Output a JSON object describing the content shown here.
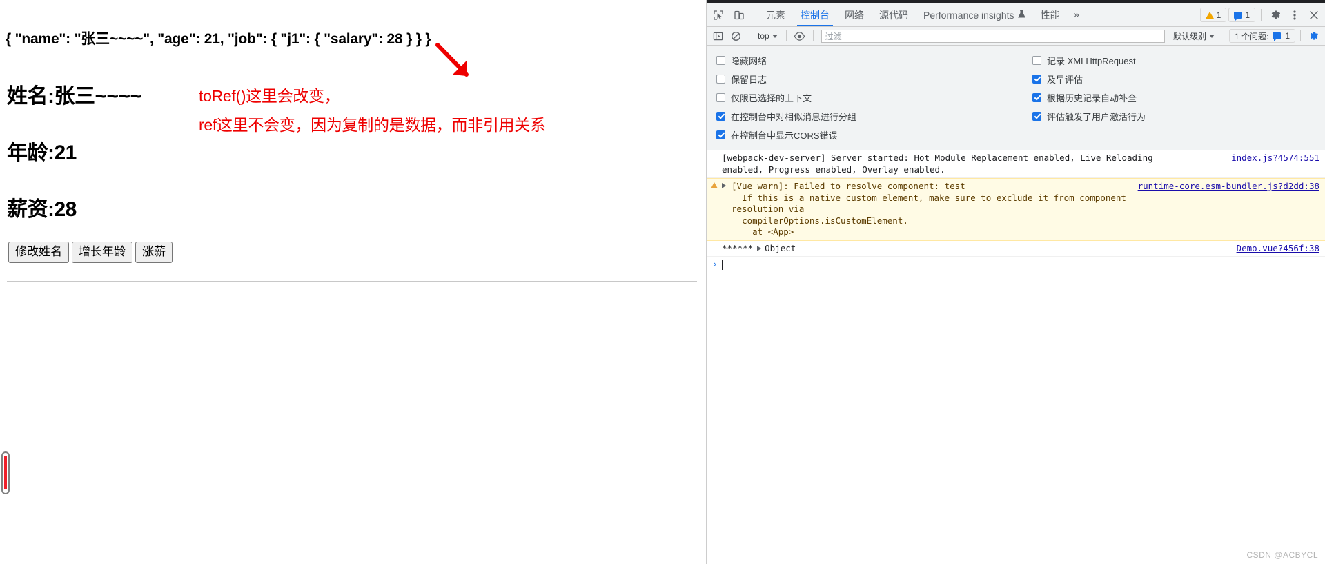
{
  "page": {
    "json_preview": "{ \"name\": \"张三~~~~\", \"age\": 21, \"job\": { \"j1\": { \"salary\": 28 } } }",
    "fields": {
      "name": "姓名:张三~~~~",
      "age": "年龄:21",
      "salary": "薪资:28"
    },
    "annotation": {
      "line1": "toRef()这里会改变，",
      "line2": "ref这里不会变，因为复制的是数据，而非引用关系",
      "color": "#ee0000"
    },
    "buttons": [
      {
        "label": "修改姓名",
        "name": "change-name-button"
      },
      {
        "label": "增长年龄",
        "name": "increase-age-button"
      },
      {
        "label": "涨薪",
        "name": "raise-salary-button"
      }
    ]
  },
  "devtools": {
    "tabs": [
      {
        "label": "元素",
        "active": false
      },
      {
        "label": "控制台",
        "active": true
      },
      {
        "label": "网络",
        "active": false
      },
      {
        "label": "源代码",
        "active": false
      },
      {
        "label": "Performance insights",
        "active": false,
        "flask": "⚗"
      },
      {
        "label": "性能",
        "active": false
      }
    ],
    "more_tabs_glyph": "»",
    "badges": {
      "warning_count": "1",
      "message_count": "1"
    },
    "console_toolbar": {
      "context": "top",
      "filter_placeholder": "过滤",
      "filter_value": "",
      "level": "默认级别",
      "issues_label": "1 个问题:",
      "issues_count": "1"
    },
    "settings_left": [
      {
        "label": "隐藏网络",
        "checked": false
      },
      {
        "label": "保留日志",
        "checked": false
      },
      {
        "label": "仅限已选择的上下文",
        "checked": false
      },
      {
        "label": "在控制台中对相似消息进行分组",
        "checked": true
      },
      {
        "label": "在控制台中显示CORS错误",
        "checked": true
      }
    ],
    "settings_right": [
      {
        "label": "记录 XMLHttpRequest",
        "checked": false
      },
      {
        "label": "及早评估",
        "checked": true
      },
      {
        "label": "根据历史记录自动补全",
        "checked": true
      },
      {
        "label": "评估触发了用户激活行为",
        "checked": true
      }
    ],
    "messages": [
      {
        "type": "log",
        "text": "[webpack-dev-server] Server started: Hot Module Replacement enabled, Live Reloading enabled, Progress enabled, Overlay enabled.",
        "source": "index.js?4574:551"
      },
      {
        "type": "warning",
        "text": "[Vue warn]: Failed to resolve component: test\n  If this is a native custom element, make sure to exclude it from component resolution via\n  compilerOptions.isCustomElement.\n    at <App>",
        "source": "runtime-core.esm-bundler.js?d2dd:38"
      },
      {
        "type": "object",
        "text": "******",
        "object_label": "Object",
        "source": "Demo.vue?456f:38"
      }
    ],
    "prompt": {
      "arrow": "›",
      "value": ""
    }
  },
  "watermark": "CSDN @ACBYCL"
}
